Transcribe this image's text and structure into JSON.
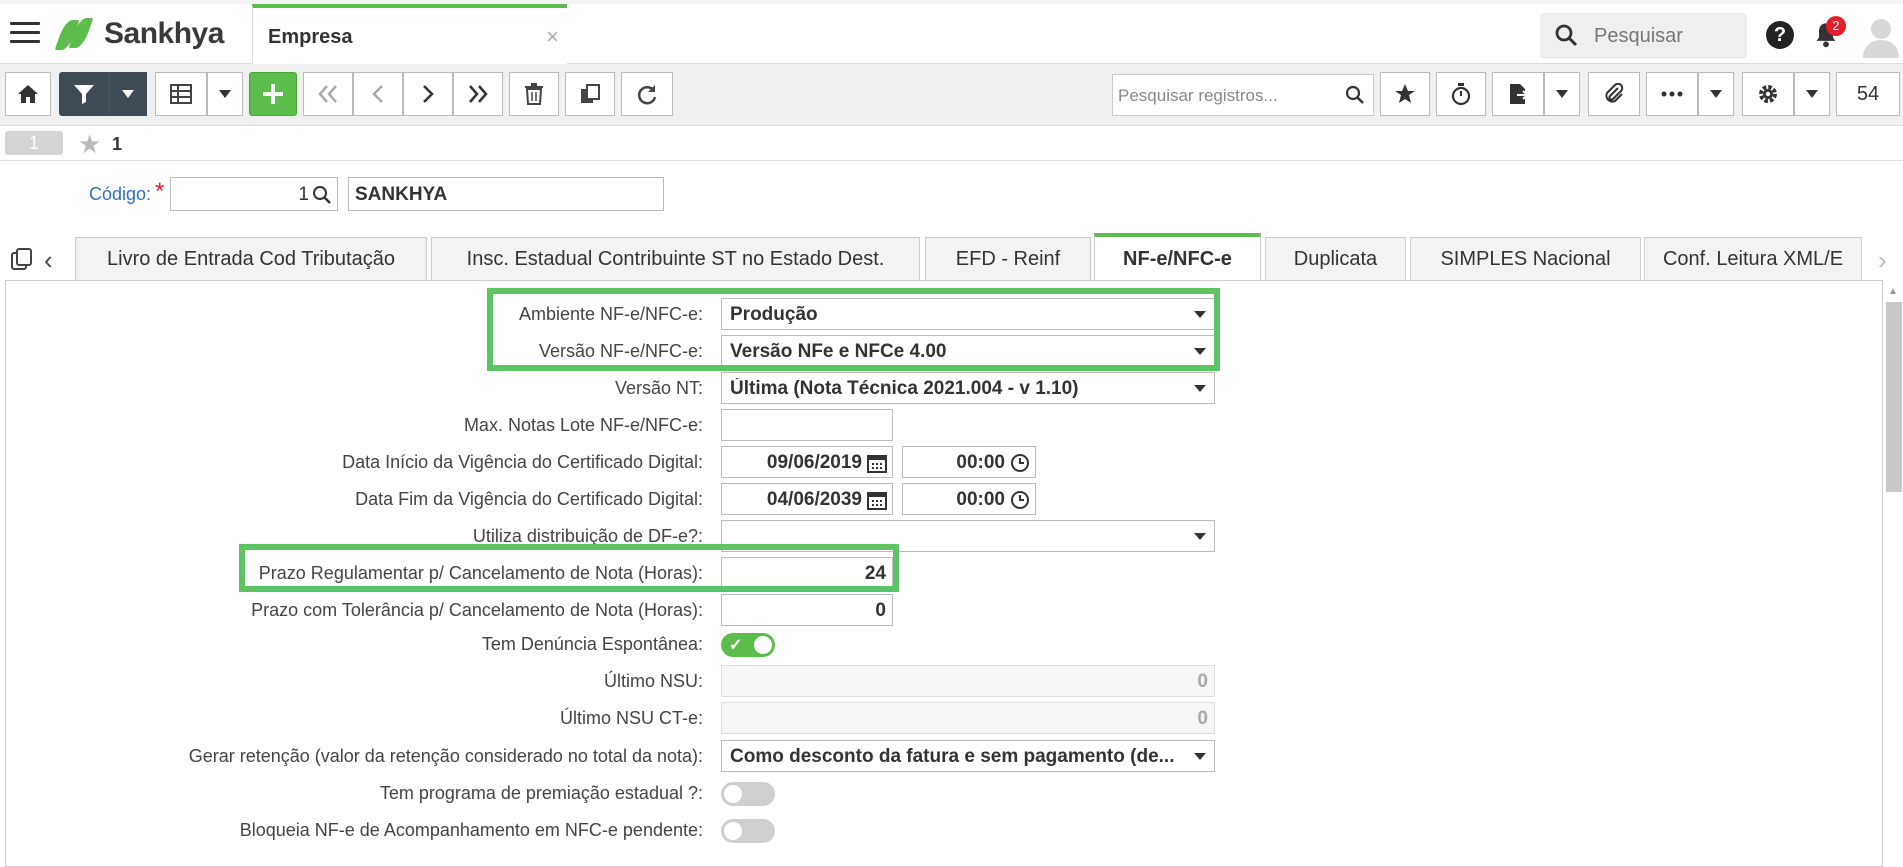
{
  "app": {
    "name": "Sankhya"
  },
  "window_tab": {
    "title": "Empresa",
    "close": "×"
  },
  "global_search": {
    "placeholder": "Pesquisar"
  },
  "notifications": {
    "count": "2"
  },
  "toolbar": {
    "search_placeholder": "Pesquisar registros...",
    "record_count": "54"
  },
  "pager": {
    "page": "1",
    "favorite_number": "1"
  },
  "record": {
    "codigo_label": "Código:",
    "required_mark": "*",
    "codigo_value": "1",
    "nome_value": "SANKHYA"
  },
  "tabs": [
    {
      "label": "Livro de Entrada Cod Tributação",
      "active": false
    },
    {
      "label": "Insc. Estadual Contribuinte ST no Estado Dest.",
      "active": false
    },
    {
      "label": "EFD - Reinf",
      "active": false
    },
    {
      "label": "NF-e/NFC-e",
      "active": true
    },
    {
      "label": "Duplicata",
      "active": false
    },
    {
      "label": "SIMPLES Nacional",
      "active": false
    },
    {
      "label": "Conf. Leitura XML/E",
      "active": false
    }
  ],
  "form": {
    "ambiente": {
      "label": "Ambiente NF-e/NFC-e:",
      "value": "Produção"
    },
    "versao": {
      "label": "Versão NF-e/NFC-e:",
      "value": "Versão NFe e NFCe 4.00"
    },
    "versao_nt": {
      "label": "Versão NT:",
      "value": "Última (Nota Técnica 2021.004 - v 1.10)"
    },
    "max_notas": {
      "label": "Max. Notas Lote NF-e/NFC-e:",
      "value": ""
    },
    "data_inicio": {
      "label": "Data Início da Vigência do Certificado Digital:",
      "date": "09/06/2019",
      "time": "00:00"
    },
    "data_fim": {
      "label": "Data Fim da Vigência do Certificado Digital:",
      "date": "04/06/2039",
      "time": "00:00"
    },
    "distribuicao": {
      "label": "Utiliza distribuição de DF-e?:",
      "value": ""
    },
    "prazo_reg": {
      "label": "Prazo Regulamentar p/ Cancelamento de Nota (Horas):",
      "value": "24"
    },
    "prazo_tol": {
      "label": "Prazo com Tolerância p/ Cancelamento de Nota (Horas):",
      "value": "0"
    },
    "denuncia": {
      "label": "Tem Denúncia Espontânea:",
      "on": true
    },
    "ultimo_nsu": {
      "label": "Último NSU:",
      "value": "0"
    },
    "ultimo_nsu_cte": {
      "label": "Último NSU CT-e:",
      "value": "0"
    },
    "retencao": {
      "label": "Gerar retenção (valor da retenção considerado no total da nota):",
      "value": "Como desconto da fatura e sem pagamento (de..."
    },
    "premiacao": {
      "label": "Tem programa de premiação estadual ?:",
      "on": false
    },
    "bloqueia": {
      "label": "Bloqueia NF-e de Acompanhamento em NFC-e pendente:",
      "on": false
    }
  },
  "colors": {
    "accent": "#5cbd4c",
    "highlight": "#5cc462",
    "dark_button": "#3f4a54",
    "badge": "#e2202a",
    "link": "#2c70c5"
  }
}
